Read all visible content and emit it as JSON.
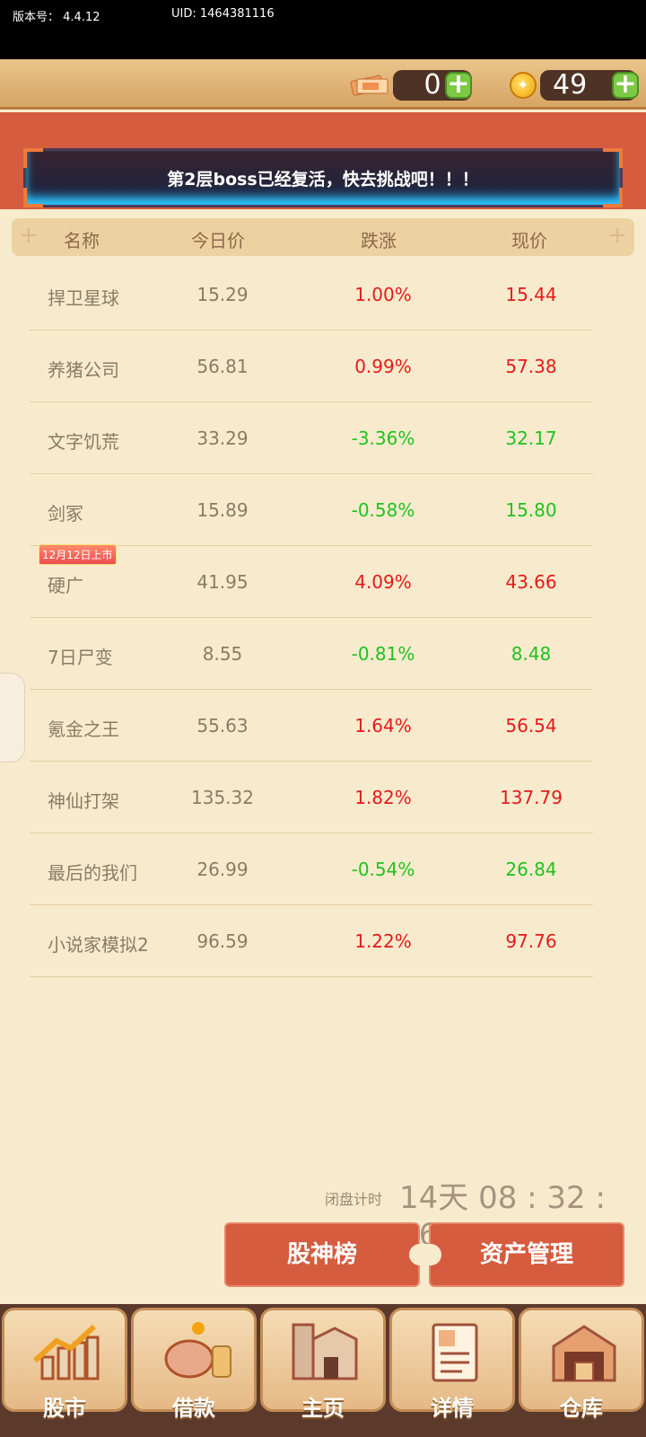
{
  "status": {
    "version_label": "版本号：",
    "version": "4.4.12",
    "uid_label": "UID:",
    "uid": "1464381116"
  },
  "resources": {
    "tickets": "0",
    "coins": "49",
    "plus": "+"
  },
  "notice": "第2层boss已经复活，快去挑战吧！！！",
  "table": {
    "headers": [
      "名称",
      "今日价",
      "跌涨",
      "现价"
    ],
    "rows": [
      {
        "name": "捍卫星球",
        "price": "15.29",
        "change": "1.00%",
        "current": "15.44",
        "trend": "up"
      },
      {
        "name": "养猪公司",
        "price": "56.81",
        "change": "0.99%",
        "current": "57.38",
        "trend": "up"
      },
      {
        "name": "文字饥荒",
        "price": "33.29",
        "change": "-3.36%",
        "current": "32.17",
        "trend": "down"
      },
      {
        "name": "剑冢",
        "price": "15.89",
        "change": "-0.58%",
        "current": "15.80",
        "trend": "down"
      },
      {
        "name": "硬广",
        "price": "41.95",
        "change": "4.09%",
        "current": "43.66",
        "trend": "up",
        "tag": "12月12日上市"
      },
      {
        "name": "7日尸变",
        "price": "8.55",
        "change": "-0.81%",
        "current": "8.48",
        "trend": "down"
      },
      {
        "name": "氪金之王",
        "price": "55.63",
        "change": "1.64%",
        "current": "56.54",
        "trend": "up"
      },
      {
        "name": "神仙打架",
        "price": "135.32",
        "change": "1.82%",
        "current": "137.79",
        "trend": "up"
      },
      {
        "name": "最后的我们",
        "price": "26.99",
        "change": "-0.54%",
        "current": "26.84",
        "trend": "down"
      },
      {
        "name": "小说家模拟2",
        "price": "96.59",
        "change": "1.22%",
        "current": "97.76",
        "trend": "up"
      }
    ]
  },
  "timer": {
    "label": "闭盘计时",
    "value": "14天 08 : 32 : 26"
  },
  "buttons": {
    "leaderboard": "股神榜",
    "assets": "资产管理"
  },
  "nav": [
    "股市",
    "借款",
    "主页",
    "详情",
    "仓库"
  ],
  "colors": {
    "up": "#e51a1a",
    "down": "#1fc21f",
    "accent": "#d55c3f"
  }
}
